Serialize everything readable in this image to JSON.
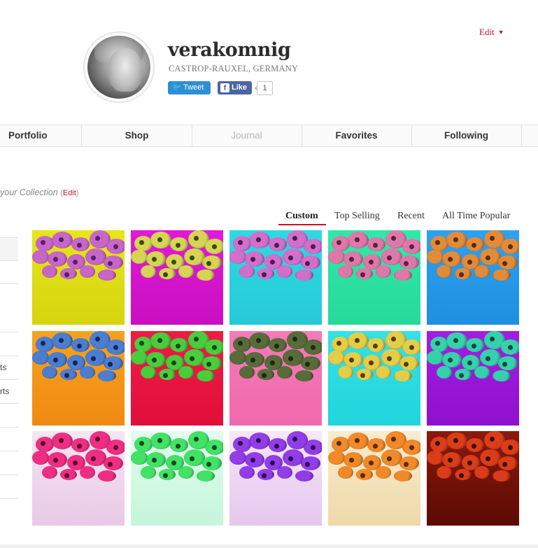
{
  "header": {
    "edit_label": "Edit",
    "username": "verakomnig",
    "location": "CASTROP-RAUXEL, GERMANY",
    "tweet_label": "Tweet",
    "like_label": "Like",
    "like_count": "1"
  },
  "nav": {
    "items": [
      {
        "label": "Portfolio",
        "disabled": false
      },
      {
        "label": "Shop",
        "disabled": false
      },
      {
        "label": "Journal",
        "disabled": true
      },
      {
        "label": "Favorites",
        "disabled": false
      },
      {
        "label": "Following",
        "disabled": false
      }
    ]
  },
  "collection": {
    "label": "your Collection",
    "edit_open": "(",
    "edit_link": "Edit",
    "edit_close": ")"
  },
  "sort": {
    "tabs": [
      "Custom",
      "Top Selling",
      "Recent",
      "All Time Popular"
    ],
    "active": "Custom"
  },
  "sidebar": {
    "fragments": [
      "ts",
      "rts"
    ]
  },
  "gallery": {
    "tiles": [
      {
        "flowers": "#c45cd6",
        "dark": "#5a1f6b",
        "bg": "#e7e51b",
        "bg2": "#d6d40f"
      },
      {
        "flowers": "#d6e44a",
        "dark": "#3a4a12",
        "bg": "#e01ad7",
        "bg2": "#c90fc0"
      },
      {
        "flowers": "#e066c8",
        "dark": "#4b1b55",
        "bg": "#30d8e4",
        "bg2": "#25cad6"
      },
      {
        "flowers": "#ec6fa8",
        "dark": "#5c2040",
        "bg": "#2fe9a9",
        "bg2": "#27d89b"
      },
      {
        "flowers": "#f08a2a",
        "dark": "#5e2a0a",
        "bg": "#2ea1f0",
        "bg2": "#1f8fe0"
      },
      {
        "flowers": "#3d7be0",
        "dark": "#13265a",
        "bg": "#f6a21f",
        "bg2": "#f08a12"
      },
      {
        "flowers": "#3ddc3d",
        "dark": "#0e4a10",
        "bg": "#ef1b45",
        "bg2": "#e00f3a"
      },
      {
        "flowers": "#4a6b30",
        "dark": "#1a2a10",
        "bg": "#f57ab8",
        "bg2": "#ef6aad"
      },
      {
        "flowers": "#f2cc3a",
        "dark": "#5a3a0a",
        "bg": "#33e2e6",
        "bg2": "#22d4dc"
      },
      {
        "flowers": "#2ee0a8",
        "dark": "#0f4a38",
        "bg": "#a21fe0",
        "bg2": "#9010d0"
      },
      {
        "flowers": "#ee1f7a",
        "dark": "#5a0a28",
        "bg": "#f4e6f2",
        "bg2": "#e9c9e6"
      },
      {
        "flowers": "#34e05a",
        "dark": "#0e4a1e",
        "bg": "#e4fbee",
        "bg2": "#c4f6da"
      },
      {
        "flowers": "#8a2fe6",
        "dark": "#2a0c55",
        "bg": "#f6e8f8",
        "bg2": "#e6c6ee"
      },
      {
        "flowers": "#f0821c",
        "dark": "#5a2a06",
        "bg": "#f7ecd0",
        "bg2": "#efd9a8"
      },
      {
        "flowers": "#e3401a",
        "dark": "#3a0a04",
        "bg": "#8a1a0c",
        "bg2": "#5c0a04"
      }
    ]
  },
  "colors": {
    "accent_red": "#c8102e",
    "tweet_blue": "#2d8fd5",
    "facebook_blue": "#4a66a0"
  }
}
